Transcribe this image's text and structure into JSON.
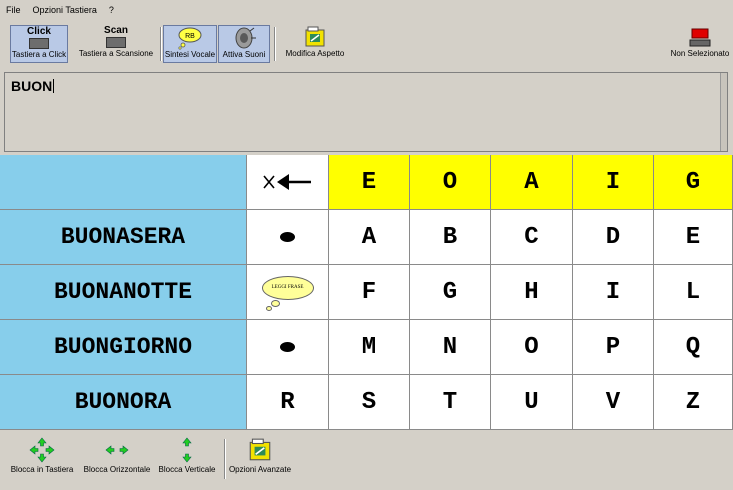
{
  "menu": [
    "File",
    "Opzioni Tastiera",
    "?"
  ],
  "toolbar": {
    "click_title": "Click",
    "click_label": "Tastiera a Click",
    "scan_title": "Scan",
    "scan_label": "Tastiera a Scansione",
    "voice_badge": "RB",
    "voice_label": "Sintesi Vocale",
    "sound_label": "Attiva Suoni",
    "appearance_label": "Modifica Aspetto",
    "not_selected_label": "Non Selezionato"
  },
  "editor": {
    "text": "BUON"
  },
  "keyboard": {
    "rows": [
      [
        "",
        "backspace",
        "E",
        "O",
        "A",
        "I",
        "G"
      ],
      [
        "BUONASERA",
        "dot",
        "A",
        "B",
        "C",
        "D",
        "E"
      ],
      [
        "BUONANOTTE",
        "read",
        "F",
        "G",
        "H",
        "I",
        "L"
      ],
      [
        "BUONGIORNO",
        "dot",
        "M",
        "N",
        "O",
        "P",
        "Q"
      ],
      [
        "BUONORA",
        "R",
        "S",
        "T",
        "U",
        "V",
        "Z"
      ]
    ],
    "read_bubble": "LEGGI FRASE"
  },
  "bottombar": {
    "lock_keyboard": "Blocca in Tastiera",
    "lock_horizontal": "Blocca Orizzontale",
    "lock_vertical": "Blocca Verticale",
    "advanced_options": "Opzioni Avanzate"
  },
  "colors": {
    "word_cell": "#87ceeb",
    "vowel_row": "#ffff00",
    "toolbar_bg": "#d4d0c8"
  }
}
